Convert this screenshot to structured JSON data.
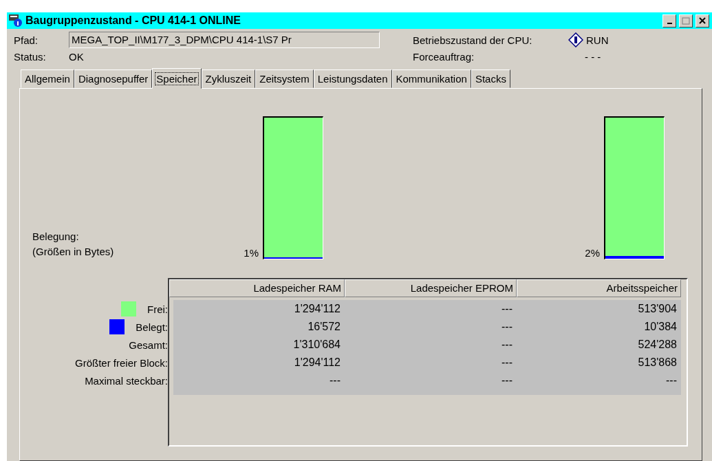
{
  "window": {
    "title": "Baugruppenzustand - CPU 414-1  ONLINE"
  },
  "info": {
    "path_label": "Pfad:",
    "path_value": "MEGA_TOP_II\\M177_3_DPM\\CPU 414-1\\S7 Pr",
    "status_label": "Status:",
    "status_value": "OK",
    "mode_label": "Betriebszustand der CPU:",
    "mode_value": "RUN",
    "force_label": "Forceauftrag:",
    "force_value": "- - -"
  },
  "tabs": [
    {
      "label": "Allgemein",
      "selected": false
    },
    {
      "label": "Diagnosepuffer",
      "selected": false
    },
    {
      "label": "Speicher",
      "selected": true
    },
    {
      "label": "Zykluszeit",
      "selected": false
    },
    {
      "label": "Zeitsystem",
      "selected": false
    },
    {
      "label": "Leistungsdaten",
      "selected": false
    },
    {
      "label": "Kommunikation",
      "selected": false
    },
    {
      "label": "Stacks",
      "selected": false
    }
  ],
  "usage": {
    "label": "Belegung:",
    "sublabel": "(Größen in Bytes)",
    "bars": [
      {
        "percent": "1%",
        "level": 0.01
      },
      {
        "percent": "2%",
        "level": 0.02
      }
    ]
  },
  "table": {
    "columns": [
      "Ladespeicher RAM",
      "Ladespeicher EPROM",
      "Arbeitsspeicher"
    ],
    "rows": [
      {
        "label": "Frei:",
        "color": "#80ff80",
        "values": [
          "1'294'112",
          "---",
          "513'904"
        ]
      },
      {
        "label": "Belegt:",
        "color": "#0000ff",
        "values": [
          "16'572",
          "---",
          "10'384"
        ]
      },
      {
        "label": "Gesamt:",
        "values": [
          "1'310'684",
          "---",
          "524'288"
        ]
      },
      {
        "label": "Größter freier Block:",
        "values": [
          "1'294'112",
          "---",
          "513'868"
        ]
      },
      {
        "label": "Maximal steckbar:",
        "values": [
          "---",
          "---",
          "---"
        ]
      }
    ]
  }
}
